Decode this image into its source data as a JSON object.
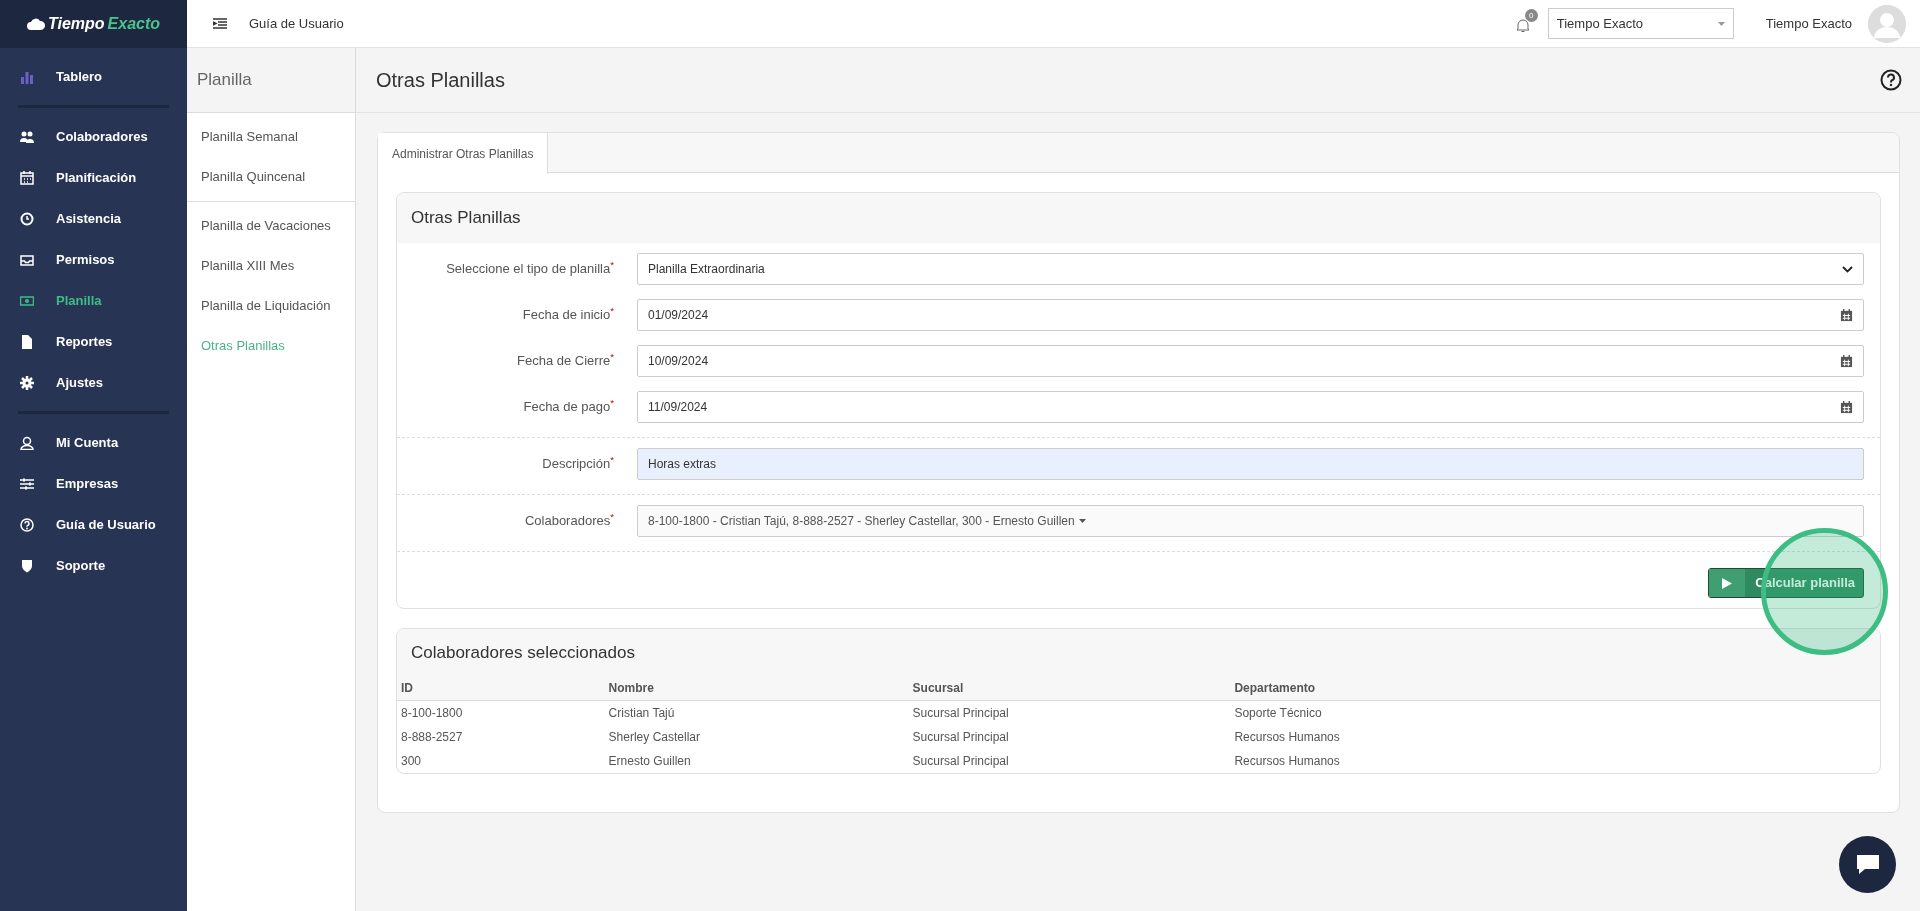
{
  "brand": {
    "part_1": "Tiempo",
    "part_2": "Exacto"
  },
  "topbar": {
    "menu_link": "Guía de Usuario",
    "notification_count": "0",
    "company_select": "Tiempo Exacto",
    "user_name": "Tiempo Exacto"
  },
  "sidebar": {
    "groups": [
      [
        {
          "label": "Tablero",
          "selected": false
        }
      ],
      [
        {
          "label": "Colaboradores",
          "selected": false
        },
        {
          "label": "Planificación",
          "selected": false
        },
        {
          "label": "Asistencia",
          "selected": false
        },
        {
          "label": "Permisos",
          "selected": false
        },
        {
          "label": "Planilla",
          "selected": true
        },
        {
          "label": "Reportes",
          "selected": false
        },
        {
          "label": "Ajustes",
          "selected": false
        }
      ],
      [
        {
          "label": "Mi Cuenta",
          "selected": false
        },
        {
          "label": "Empresas",
          "selected": false
        },
        {
          "label": "Guía de Usuario",
          "selected": false
        },
        {
          "label": "Soporte",
          "selected": false
        }
      ]
    ]
  },
  "subnav": {
    "title": "Planilla",
    "groups": [
      [
        {
          "label": "Planilla Semanal",
          "selected": false
        },
        {
          "label": "Planilla Quincenal",
          "selected": false
        }
      ],
      [
        {
          "label": "Planilla de Vacaciones",
          "selected": false
        },
        {
          "label": "Planilla XIII Mes",
          "selected": false
        },
        {
          "label": "Planilla de Liquidación",
          "selected": false
        },
        {
          "label": "Otras Planillas",
          "selected": true
        }
      ]
    ]
  },
  "page": {
    "title": "Otras Planillas"
  },
  "tabs": [
    {
      "label": "Administrar Otras Planillas",
      "selected": true
    }
  ],
  "form": {
    "title": "Otras Planillas",
    "sections": [
      {
        "fields": [
          {
            "kind": "select",
            "label": "Seleccione el tipo de planilla$^{*}$",
            "value": "Planilla Extraordinaria"
          },
          {
            "kind": "date",
            "label": "Fecha de inicio$^{*}$",
            "value": "01/09/2024"
          },
          {
            "kind": "date",
            "label": "Fecha de Cierre$^{*}$",
            "value": "10/09/2024"
          },
          {
            "kind": "date",
            "label": "Fecha de pago$^{*}$",
            "value": "11/09/2024"
          }
        ]
      },
      {
        "fields": [
          {
            "kind": "text",
            "label": "Descripción$^{*}$",
            "value": "Horas extras"
          }
        ]
      },
      {
        "fields": [
          {
            "kind": "multiselect",
            "label": "Colaboradores$^{*}$",
            "value": "8-100-1800 - Cristian Tajú, 8-888-2527 - Sherley Castellar, 300 - Ernesto Guillen"
          }
        ]
      }
    ],
    "button": {
      "label": "Calcular planilla"
    },
    "click_highlight": true
  },
  "selected_table": {
    "title": "Colaboradores seleccionados",
    "columns": [
      "ID",
      "Nombre",
      "Sucursal",
      "Departamento"
    ],
    "rows": [
      [
        "8-100-1800",
        "Cristian Tajú",
        "Sucursal Principal",
        "Soporte Técnico"
      ],
      [
        "8-888-2527",
        "Sherley Castellar",
        "Sucursal Principal",
        "Recursos Humanos"
      ],
      [
        "300",
        "Ernesto Guillen",
        "Sucursal Principal",
        "Recursos Humanos"
      ]
    ]
  }
}
